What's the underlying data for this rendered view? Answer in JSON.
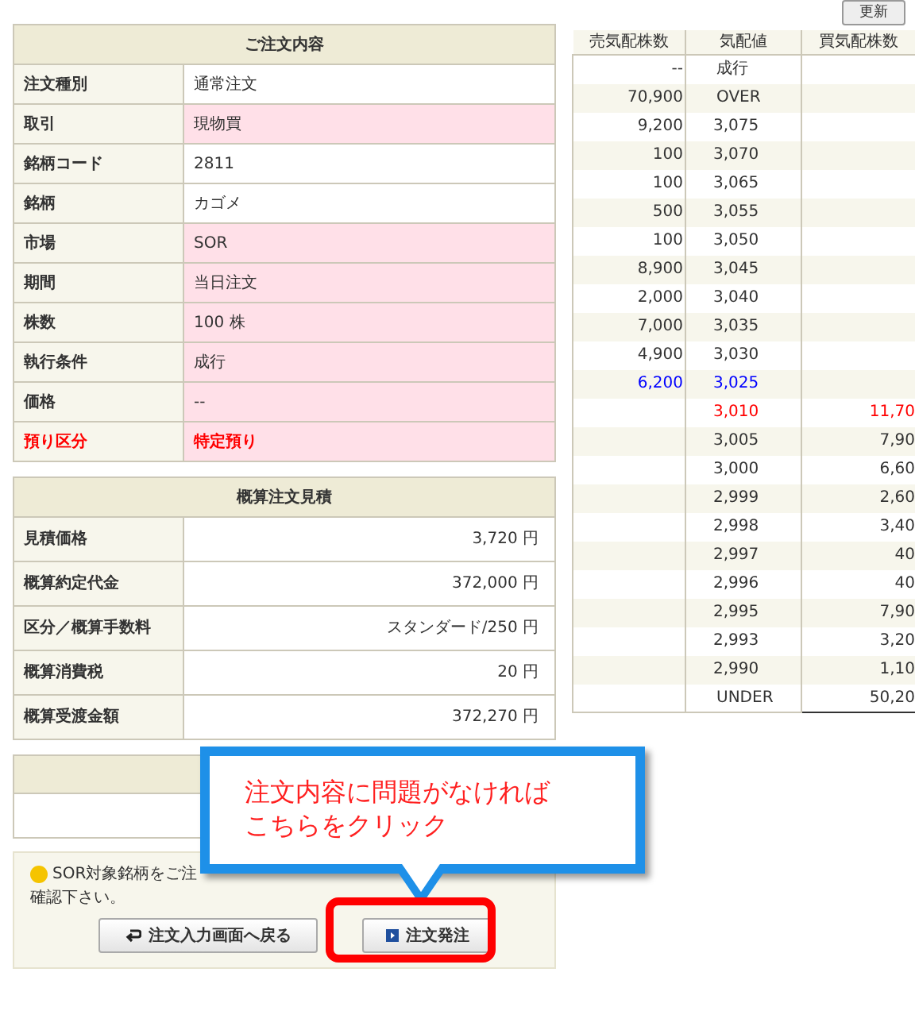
{
  "refresh_button": "更新",
  "order": {
    "title": "ご注文内容",
    "rows": [
      {
        "label": "注文種別",
        "value": "通常注文",
        "highlighted": false,
        "emphasis": false
      },
      {
        "label": "取引",
        "value": "現物買",
        "highlighted": true,
        "emphasis": false
      },
      {
        "label": "銘柄コード",
        "value": "2811",
        "highlighted": false,
        "emphasis": false
      },
      {
        "label": "銘柄",
        "value": "カゴメ",
        "highlighted": false,
        "emphasis": false
      },
      {
        "label": "市場",
        "value": "SOR",
        "highlighted": true,
        "emphasis": false
      },
      {
        "label": "期間",
        "value": "当日注文",
        "highlighted": true,
        "emphasis": false
      },
      {
        "label": "株数",
        "value": "100 株",
        "highlighted": true,
        "emphasis": false
      },
      {
        "label": "執行条件",
        "value": "成行",
        "highlighted": true,
        "emphasis": false
      },
      {
        "label": "価格",
        "value": "--",
        "highlighted": true,
        "emphasis": false
      },
      {
        "label": "預り区分",
        "value": "特定預り",
        "highlighted": true,
        "emphasis": true
      }
    ]
  },
  "estimate": {
    "title": "概算注文見積",
    "rows": [
      {
        "label": "見積価格",
        "value": "3,720 円"
      },
      {
        "label": "概算約定代金",
        "value": "372,000 円"
      },
      {
        "label": "区分／概算手数料",
        "value": "スタンダード/250 円"
      },
      {
        "label": "概算消費税",
        "value": "20 円"
      },
      {
        "label": "概算受渡金額",
        "value": "372,270 円"
      }
    ]
  },
  "notice": {
    "line_1": "SOR対象銘柄をご注",
    "line_2": "確認下さい。"
  },
  "buttons": [
    {
      "kind": "back",
      "label": "注文入力画面へ戻る"
    },
    {
      "kind": "submit",
      "label": "注文発注"
    }
  ],
  "callout": {
    "line_1": "注文内容に問題がなければ",
    "line_2": "こちらをクリック"
  },
  "board": {
    "columns": [
      "売気配株数",
      "気配値",
      "買気配株数"
    ],
    "rows": [
      {
        "sell": "--",
        "price": "成行",
        "buy": ""
      },
      {
        "sell": "70,900",
        "price": "OVER",
        "buy": ""
      },
      {
        "sell": "9,200",
        "price": "3,075",
        "buy": ""
      },
      {
        "sell": "100",
        "price": "3,070",
        "buy": ""
      },
      {
        "sell": "100",
        "price": "3,065",
        "buy": ""
      },
      {
        "sell": "500",
        "price": "3,055",
        "buy": ""
      },
      {
        "sell": "100",
        "price": "3,050",
        "buy": ""
      },
      {
        "sell": "8,900",
        "price": "3,045",
        "buy": ""
      },
      {
        "sell": "2,000",
        "price": "3,040",
        "buy": ""
      },
      {
        "sell": "7,000",
        "price": "3,035",
        "buy": ""
      },
      {
        "sell": "4,900",
        "price": "3,030",
        "buy": ""
      },
      {
        "sell": "6,200",
        "price": "3,025",
        "buy": "",
        "color": "#0000ff"
      },
      {
        "sell": "",
        "price": "3,010",
        "buy": "11,70",
        "color": "#ff0000"
      },
      {
        "sell": "",
        "price": "3,005",
        "buy": "7,90"
      },
      {
        "sell": "",
        "price": "3,000",
        "buy": "6,60"
      },
      {
        "sell": "",
        "price": "2,999",
        "buy": "2,60"
      },
      {
        "sell": "",
        "price": "2,998",
        "buy": "3,40"
      },
      {
        "sell": "",
        "price": "2,997",
        "buy": "40"
      },
      {
        "sell": "",
        "price": "2,996",
        "buy": "40"
      },
      {
        "sell": "",
        "price": "2,995",
        "buy": "7,90"
      },
      {
        "sell": "",
        "price": "2,993",
        "buy": "3,20"
      },
      {
        "sell": "",
        "price": "2,990",
        "buy": "1,10"
      },
      {
        "sell": "",
        "price": "UNDER",
        "buy": "50,20"
      }
    ]
  }
}
